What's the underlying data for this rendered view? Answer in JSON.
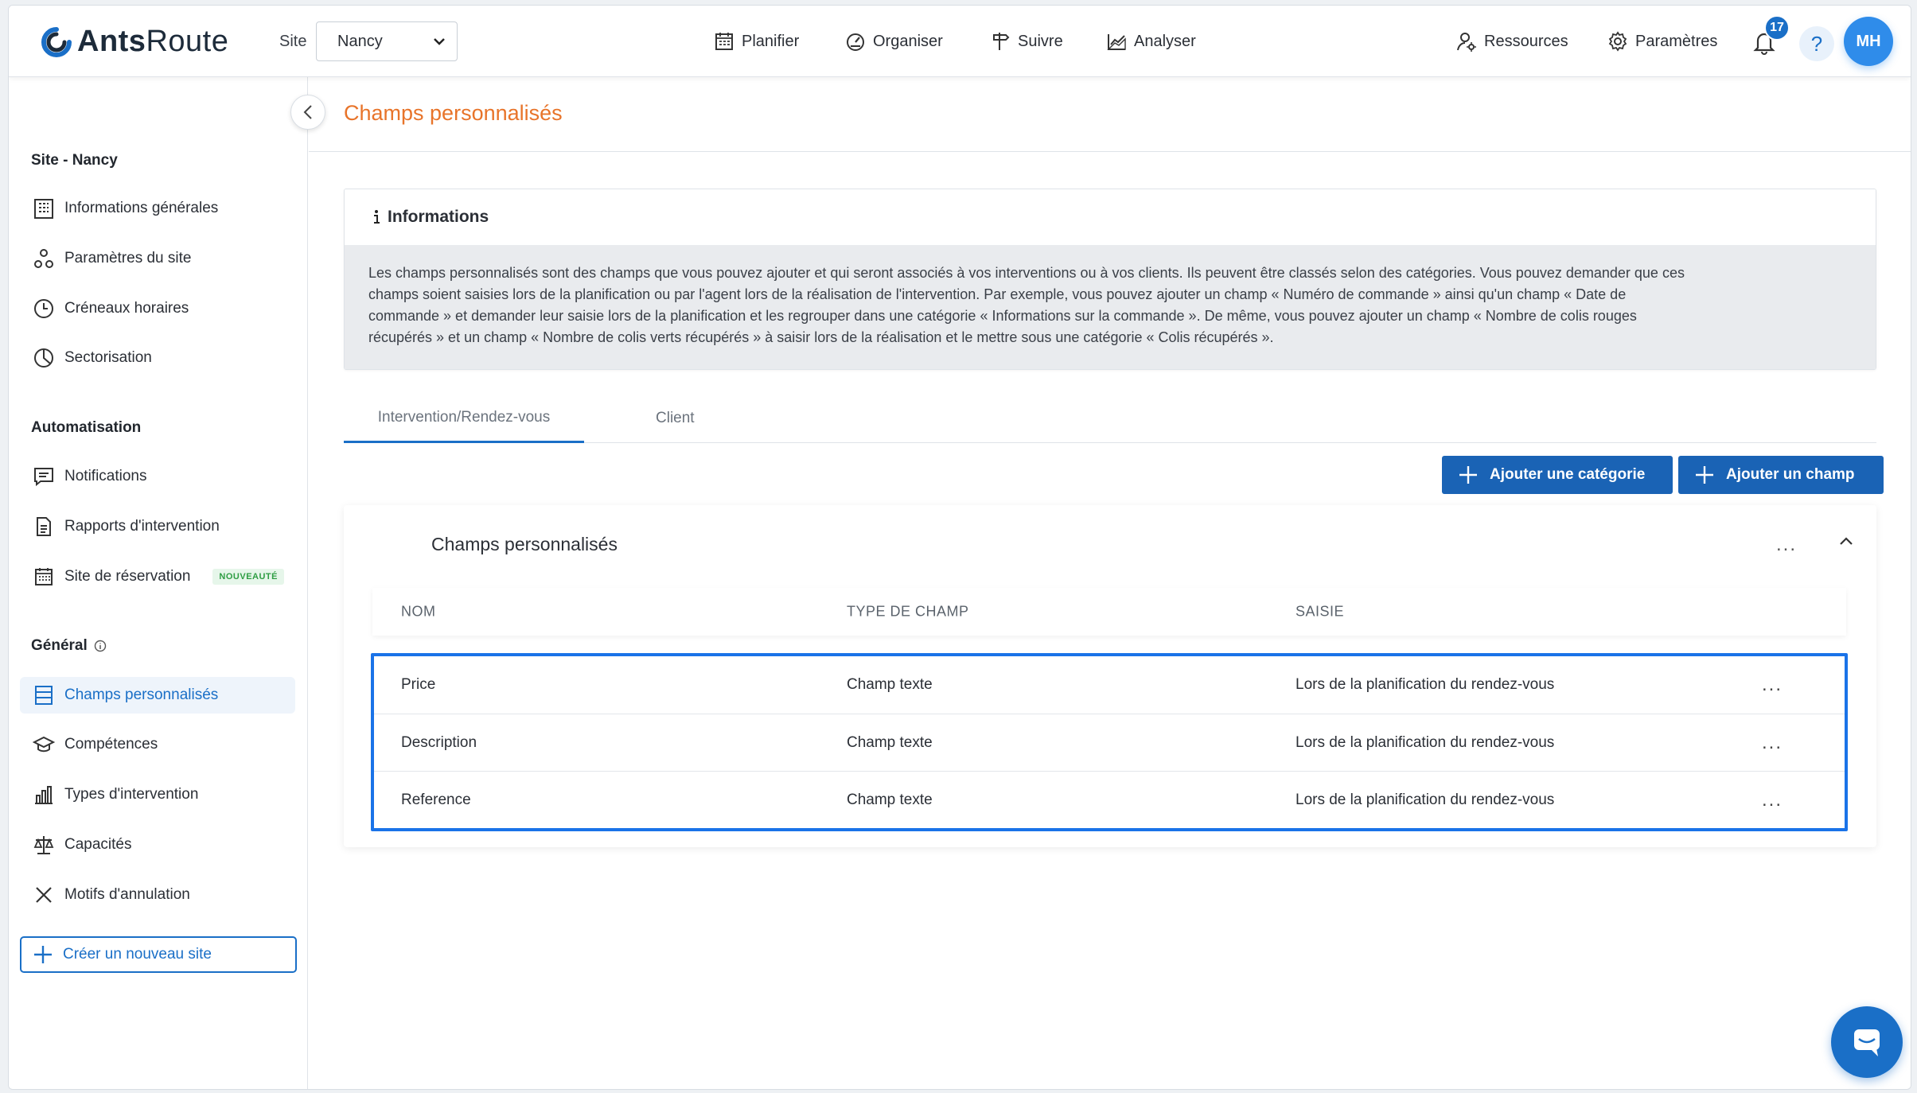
{
  "app": {
    "logo_bold": "Ants",
    "logo_light": "Route",
    "brand_color": "#1a6fc7",
    "accent_orange": "#e8742a"
  },
  "header": {
    "site_label": "Site",
    "site_value": "Nancy",
    "nav": [
      {
        "label": "Planifier",
        "icon": "calendar-icon"
      },
      {
        "label": "Organiser",
        "icon": "gauge-icon"
      },
      {
        "label": "Suivre",
        "icon": "signpost-icon"
      },
      {
        "label": "Analyser",
        "icon": "chart-icon"
      }
    ],
    "resources_label": "Ressources",
    "settings_label": "Paramètres",
    "notifications_count": "17",
    "help_label": "?",
    "avatar_initials": "MH"
  },
  "sidebar": {
    "section_site": "Site - Nancy",
    "site_items": [
      {
        "label": "Informations générales",
        "icon": "building-icon"
      },
      {
        "label": "Paramètres du site",
        "icon": "nodes-icon"
      },
      {
        "label": "Créneaux horaires",
        "icon": "clock-icon"
      },
      {
        "label": "Sectorisation",
        "icon": "pie-icon"
      }
    ],
    "section_automation": "Automatisation",
    "automation_items": [
      {
        "label": "Notifications",
        "icon": "message-icon"
      },
      {
        "label": "Rapports d'intervention",
        "icon": "document-icon"
      },
      {
        "label": "Site de réservation",
        "icon": "calendar-grid-icon",
        "badge": "NOUVEAUTÉ"
      }
    ],
    "section_general": "Général",
    "general_items": [
      {
        "label": "Champs personnalisés",
        "icon": "list-icon",
        "active": true
      },
      {
        "label": "Compétences",
        "icon": "graduation-icon"
      },
      {
        "label": "Types d'intervention",
        "icon": "bar-chart-icon"
      },
      {
        "label": "Capacités",
        "icon": "scale-icon"
      },
      {
        "label": "Motifs d'annulation",
        "icon": "x-icon"
      }
    ],
    "create_site_label": "Créer un nouveau site"
  },
  "main": {
    "page_title": "Champs personnalisés",
    "info_title": "Informations",
    "info_lines": [
      "Les champs personnalisés sont des champs que vous pouvez ajouter et qui seront associés à vos interventions ou à vos clients. Ils peuvent être classés selon des catégories. Vous pouvez demander que ces",
      "champs soient saisies lors de la planification ou par l'agent lors de la réalisation de l'intervention. Par exemple, vous pouvez ajouter un champ « Numéro de commande » ainsi qu'un champ « Date de",
      "commande » et demander leur saisie lors de la planification et les regrouper dans une catégorie « Informations sur la commande ». De même, vous pouvez ajouter un champ « Nombre de colis rouges",
      "récupérés » et un champ « Nombre de colis verts récupérés » à saisir lors de la réalisation et le mettre sous une catégorie « Colis récupérés »."
    ],
    "tabs": [
      "Intervention/Rendez-vous",
      "Client"
    ],
    "btn_add_category": "Ajouter une catégorie",
    "btn_add_field": "Ajouter un champ",
    "card_title": "Champs personnalisés",
    "card_menu": "...",
    "columns": [
      "NOM",
      "TYPE DE CHAMP",
      "SAISIE"
    ],
    "rows": [
      {
        "name": "Price",
        "type": "Champ texte",
        "input": "Lors de la planification du rendez-vous",
        "menu": "..."
      },
      {
        "name": "Description",
        "type": "Champ texte",
        "input": "Lors de la planification du rendez-vous",
        "menu": "..."
      },
      {
        "name": "Reference",
        "type": "Champ texte",
        "input": "Lors de la planification du rendez-vous",
        "menu": "..."
      }
    ]
  }
}
